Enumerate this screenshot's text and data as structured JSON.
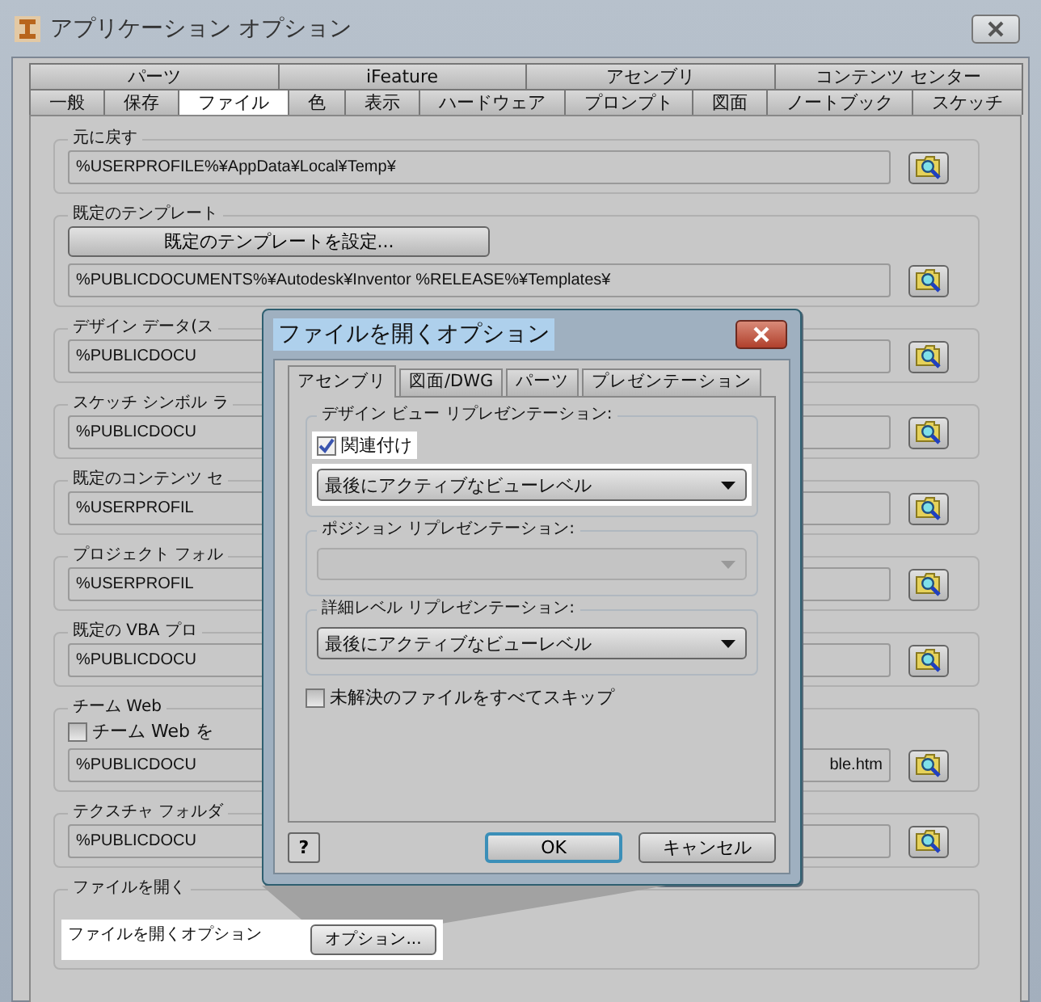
{
  "window": {
    "title": "アプリケーション オプション"
  },
  "tab_rows": [
    [
      {
        "label": "パーツ",
        "selected": false
      },
      {
        "label": "iFeature",
        "selected": false
      },
      {
        "label": "アセンブリ",
        "selected": false
      },
      {
        "label": "コンテンツ センター",
        "selected": false
      }
    ],
    [
      {
        "label": "一般",
        "selected": false
      },
      {
        "label": "保存",
        "selected": false
      },
      {
        "label": "ファイル",
        "selected": true
      },
      {
        "label": "色",
        "selected": false
      },
      {
        "label": "表示",
        "selected": false
      },
      {
        "label": "ハードウェア",
        "selected": false
      },
      {
        "label": "プロンプト",
        "selected": false
      },
      {
        "label": "図面",
        "selected": false
      },
      {
        "label": "ノートブック",
        "selected": false
      },
      {
        "label": "スケッチ",
        "selected": false
      }
    ]
  ],
  "groups": [
    {
      "kind": "path",
      "title": "元に戻す",
      "value": "%USERPROFILE%¥AppData¥Local¥Temp¥"
    },
    {
      "kind": "template",
      "title": "既定のテンプレート",
      "button": "既定のテンプレートを設定...",
      "value": "%PUBLICDOCUMENTS%¥Autodesk¥Inventor %RELEASE%¥Templates¥"
    },
    {
      "kind": "path",
      "title": "デザイン データ(ス",
      "value": "%PUBLICDOCU"
    },
    {
      "kind": "path",
      "title": "スケッチ シンボル ラ",
      "value": "%PUBLICDOCU"
    },
    {
      "kind": "path",
      "title": "既定のコンテンツ セ",
      "value": "%USERPROFIL"
    },
    {
      "kind": "path",
      "title": "プロジェクト フォル",
      "value": "%USERPROFIL"
    },
    {
      "kind": "path",
      "title": "既定の VBA プロ",
      "value": "%PUBLICDOCU"
    },
    {
      "kind": "checkbox_path",
      "title": "チーム Web",
      "checkbox": {
        "label": "チーム Web を",
        "checked": false
      },
      "value": "%PUBLICDOCU",
      "value_tail": "ble.htm"
    },
    {
      "kind": "path",
      "title": "テクスチャ フォルダ",
      "value": "%PUBLICDOCU"
    },
    {
      "kind": "open",
      "title": "ファイルを開く",
      "label": "ファイルを開くオプション",
      "button": "オプション...",
      "highlighted": true
    }
  ],
  "dialog": {
    "title": "ファイルを開くオプション",
    "tabs": [
      {
        "label": "アセンブリ",
        "selected": true
      },
      {
        "label": "図面/DWG",
        "selected": false
      },
      {
        "label": "パーツ",
        "selected": false
      },
      {
        "label": "プレゼンテーション",
        "selected": false
      }
    ],
    "groups": [
      {
        "title": "デザイン ビュー リプレゼンテーション:",
        "checkbox": {
          "label": "関連付け",
          "checked": true,
          "highlighted": true
        },
        "select": {
          "value": "最後にアクティブなビューレベル",
          "disabled": false,
          "highlighted": true
        }
      },
      {
        "title": "ポジション リプレゼンテーション:",
        "select": {
          "disabled": true,
          "highlighted": false
        }
      },
      {
        "title": "詳細レベル リプレゼンテーション:",
        "select": {
          "value": "最後にアクティブなビューレベル",
          "disabled": false,
          "highlighted": false
        }
      }
    ],
    "skip_checkbox": {
      "label": "未解決のファイルをすべてスキップ",
      "checked": false
    },
    "help_button": "?",
    "buttons": [
      {
        "label": "OK",
        "default": true
      },
      {
        "label": "キャンセル",
        "default": false
      }
    ]
  }
}
